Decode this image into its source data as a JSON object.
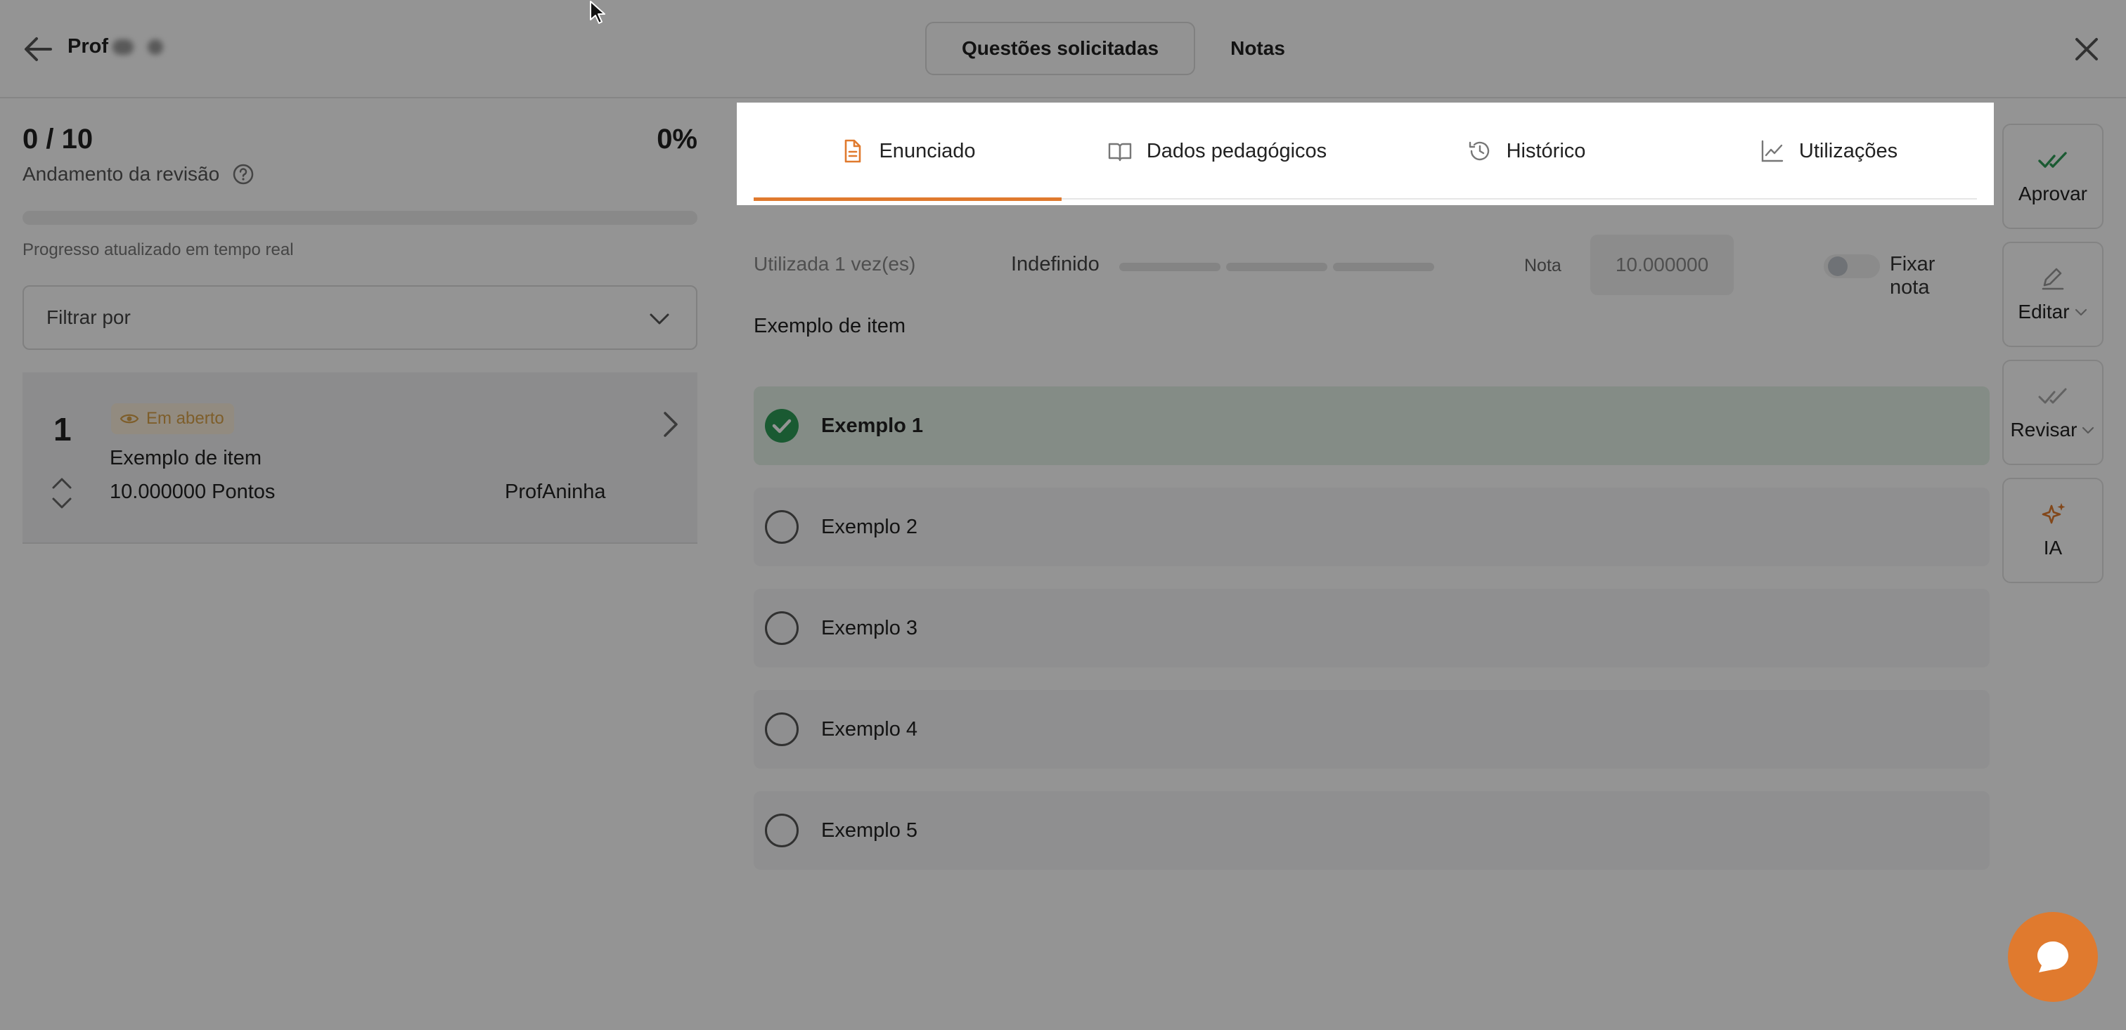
{
  "header": {
    "prof_name": "Prof",
    "tabs": [
      {
        "label": "Questões solicitadas",
        "active": true
      },
      {
        "label": "Notas",
        "active": false
      }
    ]
  },
  "review": {
    "score": "0 / 10",
    "percent": "0%",
    "progress_fraction": 0,
    "label": "Andamento da revisão",
    "note": "Progresso atualizado em tempo real",
    "filter_placeholder": "Filtrar por"
  },
  "item": {
    "number": "1",
    "status": "Em aberto",
    "title": "Exemplo de item",
    "points": "10.000000 Pontos",
    "author": "ProfAninha"
  },
  "content_tabs": [
    {
      "label": "Enunciado",
      "icon": "document-icon",
      "active": true
    },
    {
      "label": "Dados pedagógicos",
      "icon": "book-icon",
      "active": false
    },
    {
      "label": "Histórico",
      "icon": "history-icon",
      "active": false
    },
    {
      "label": "Utilizações",
      "icon": "chart-icon",
      "active": false
    }
  ],
  "meta": {
    "usage": "Utilizada 1 vez(es)",
    "difficulty": "Indefinido",
    "nota_label": "Nota",
    "nota_value": "10.000000",
    "fixar_label": "Fixar nota",
    "fixar_on": false
  },
  "statement": "Exemplo de item",
  "options": [
    {
      "label": "Exemplo 1",
      "correct": true
    },
    {
      "label": "Exemplo 2",
      "correct": false
    },
    {
      "label": "Exemplo 3",
      "correct": false
    },
    {
      "label": "Exemplo 4",
      "correct": false
    },
    {
      "label": "Exemplo 5",
      "correct": false
    }
  ],
  "actions": [
    {
      "label": "Aprovar",
      "icon": "double-check-icon"
    },
    {
      "label": "Editar",
      "icon": "edit-icon",
      "dropdown": true
    },
    {
      "label": "Revisar",
      "icon": "double-check-icon",
      "dropdown": true
    },
    {
      "label": "IA",
      "icon": "sparkles-icon"
    }
  ],
  "colors": {
    "accent": "#e07a2e",
    "success": "#2e9b57",
    "badge_bg": "#fbf0dc",
    "badge_text": "#d9a24a"
  }
}
